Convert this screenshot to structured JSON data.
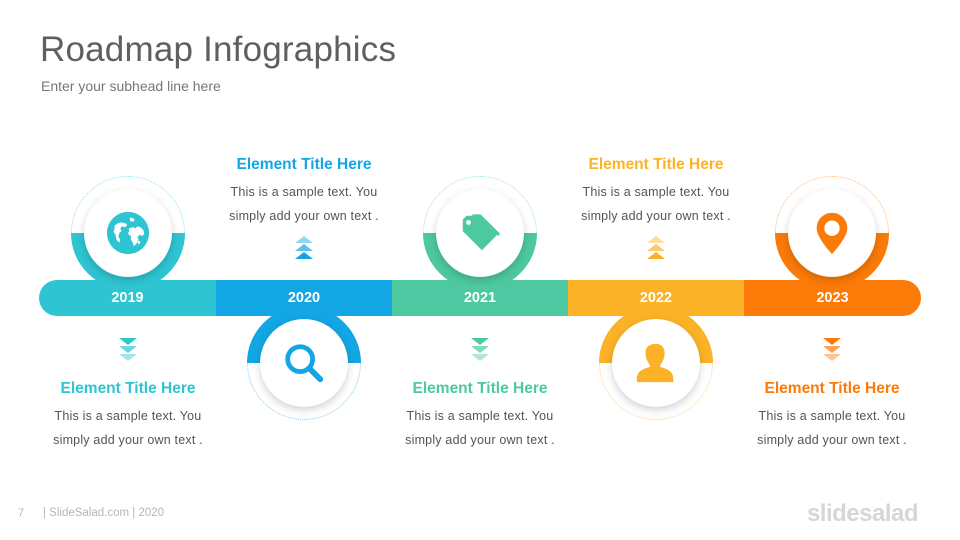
{
  "header": {
    "title": "Roadmap Infographics",
    "subtitle": "Enter your subhead line here"
  },
  "milestones": [
    {
      "year": "2019",
      "color": "#2ec4d2",
      "icon": "globe-icon",
      "position": "below-text",
      "title": "Element Title Here",
      "line1": "This is a sample text. You",
      "line2": "simply add your own text ."
    },
    {
      "year": "2020",
      "color": "#13a6e4",
      "icon": "search-icon",
      "position": "above-text",
      "title": "Element Title Here",
      "line1": "This is a sample text. You",
      "line2": "simply add your own text ."
    },
    {
      "year": "2021",
      "color": "#4dc8a0",
      "icon": "tag-icon",
      "position": "below-text",
      "title": "Element Title Here",
      "line1": "This is a sample text. You",
      "line2": "simply add your own text ."
    },
    {
      "year": "2022",
      "color": "#fbb227",
      "icon": "user-icon",
      "position": "above-text",
      "title": "Element Title Here",
      "line1": "This is a sample text. You",
      "line2": "simply add your own text ."
    },
    {
      "year": "2023",
      "color": "#fb7a08",
      "icon": "map-pin-icon",
      "position": "below-text",
      "title": "Element Title Here",
      "line1": "This is a sample text. You",
      "line2": "simply add your own text ."
    }
  ],
  "footer": {
    "page_number": "7",
    "text": "| SlideSalad.com | 2020",
    "brand": "slidesalad"
  }
}
